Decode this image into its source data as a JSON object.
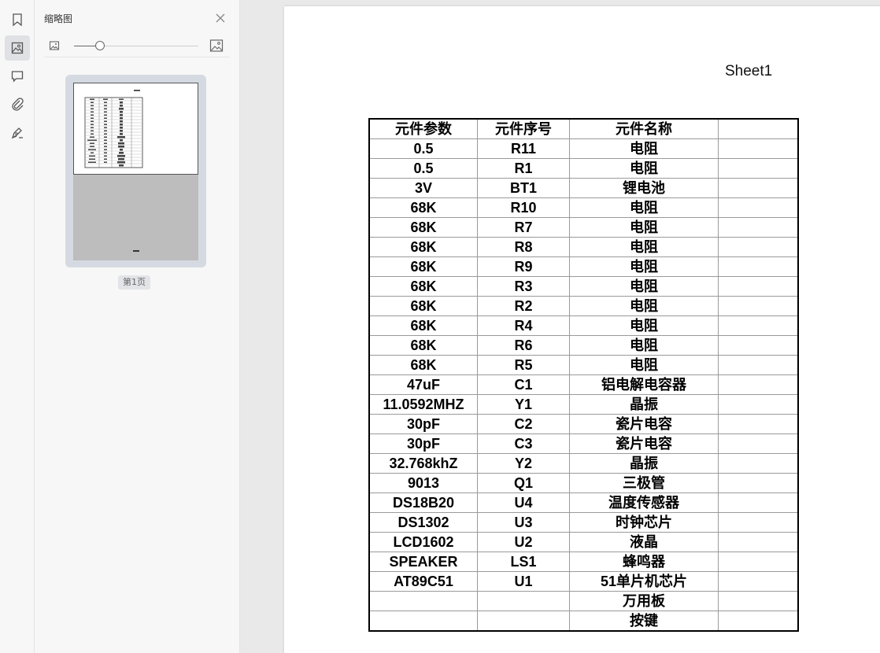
{
  "sidebar_rail": {
    "items": [
      {
        "icon": "bookmark-icon"
      },
      {
        "icon": "thumbnail-icon",
        "active": true
      },
      {
        "icon": "comment-icon"
      },
      {
        "icon": "attachment-icon"
      },
      {
        "icon": "signature-icon"
      }
    ]
  },
  "thumbnail_panel": {
    "title": "缩略图",
    "zoom_level": 0.2,
    "pages": [
      {
        "label": "第1页",
        "selected": true
      }
    ]
  },
  "document": {
    "sheet_title": "Sheet1",
    "table": {
      "headers": [
        "元件参数",
        "元件序号",
        "元件名称",
        ""
      ],
      "rows": [
        [
          "0.5",
          "R11",
          "电阻",
          ""
        ],
        [
          "0.5",
          "R1",
          "电阻",
          ""
        ],
        [
          "3V",
          "BT1",
          "锂电池",
          ""
        ],
        [
          "68K",
          "R10",
          "电阻",
          ""
        ],
        [
          "68K",
          "R7",
          "电阻",
          ""
        ],
        [
          "68K",
          "R8",
          "电阻",
          ""
        ],
        [
          "68K",
          "R9",
          "电阻",
          ""
        ],
        [
          "68K",
          "R3",
          "电阻",
          ""
        ],
        [
          "68K",
          "R2",
          "电阻",
          ""
        ],
        [
          "68K",
          "R4",
          "电阻",
          ""
        ],
        [
          "68K",
          "R6",
          "电阻",
          ""
        ],
        [
          "68K",
          "R5",
          "电阻",
          ""
        ],
        [
          "47uF",
          "C1",
          "铝电解电容器",
          ""
        ],
        [
          "11.0592MHZ",
          "Y1",
          "晶振",
          ""
        ],
        [
          "30pF",
          "C2",
          "瓷片电容",
          ""
        ],
        [
          "30pF",
          "C3",
          "瓷片电容",
          ""
        ],
        [
          "32.768khZ",
          "Y2",
          "晶振",
          ""
        ],
        [
          "9013",
          "Q1",
          "三极管",
          ""
        ],
        [
          "DS18B20",
          "U4",
          "温度传感器",
          ""
        ],
        [
          "DS1302",
          "U3",
          "时钟芯片",
          ""
        ],
        [
          "LCD1602",
          "U2",
          "液晶",
          ""
        ],
        [
          "SPEAKER",
          "LS1",
          "蜂鸣器",
          ""
        ],
        [
          "AT89C51",
          "U1",
          "51单片机芯片",
          ""
        ],
        [
          "",
          "",
          "万用板",
          ""
        ],
        [
          "",
          "",
          "按键",
          ""
        ]
      ]
    }
  }
}
